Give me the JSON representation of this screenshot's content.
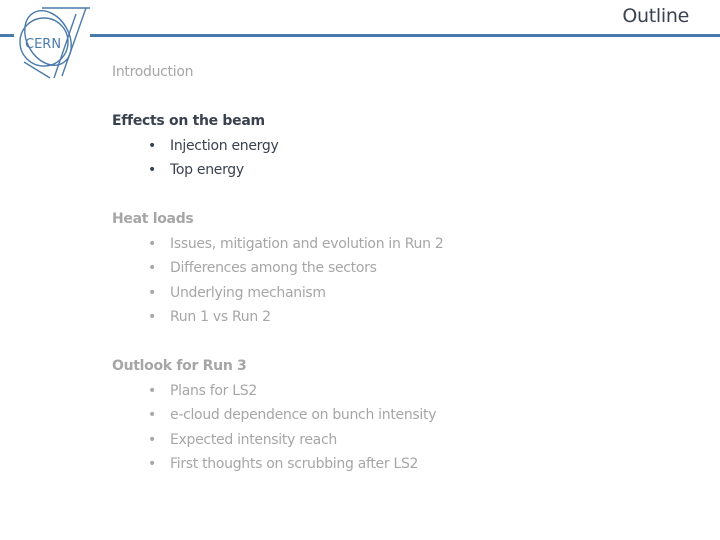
{
  "header": {
    "title": "Outline",
    "logo_text": "CERN",
    "rule_color": "#4a7aab"
  },
  "outline": {
    "sections": [
      {
        "heading": "Introduction",
        "state": "inactive",
        "items": []
      },
      {
        "heading": "Effects on the beam",
        "state": "active",
        "items": [
          "Injection energy",
          "Top energy"
        ]
      },
      {
        "heading": "Heat loads",
        "state": "inactive",
        "items": [
          "Issues, mitigation and evolution in Run 2",
          "Differences among the sectors",
          "Underlying mechanism",
          "Run 1 vs Run 2"
        ]
      },
      {
        "heading": "Outlook for Run 3",
        "state": "inactive",
        "items": [
          "Plans for LS2",
          "e-cloud dependence on bunch intensity",
          "Expected intensity reach",
          "First thoughts on scrubbing after LS2"
        ]
      }
    ],
    "bullet": "•",
    "colors": {
      "active": "#3a4250",
      "inactive": "#a6a6a6"
    }
  }
}
